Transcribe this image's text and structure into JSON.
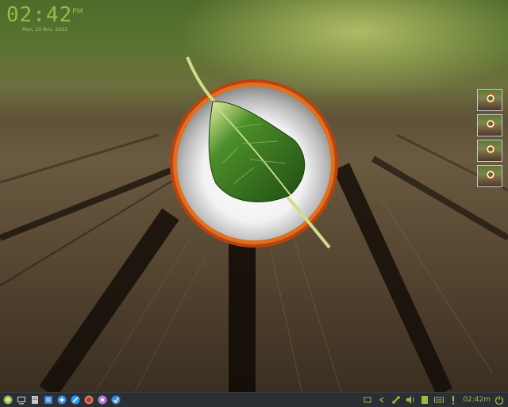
{
  "desktop": {
    "clock": {
      "time": "02:42",
      "ampm": "PM",
      "date": "Mon, 20 Nov, 2023"
    },
    "workspaces": [
      {
        "index": 1
      },
      {
        "index": 2
      },
      {
        "index": 3
      },
      {
        "index": 4
      }
    ]
  },
  "taskbar": {
    "launchers": [
      {
        "icon": "app-menu-icon"
      },
      {
        "icon": "terminal-icon"
      },
      {
        "icon": "file-manager-icon"
      },
      {
        "icon": "text-editor-icon"
      },
      {
        "icon": "settings-icon"
      },
      {
        "icon": "web-browser-icon"
      },
      {
        "icon": "firefox-icon"
      },
      {
        "icon": "media-player-icon"
      },
      {
        "icon": "software-center-icon"
      }
    ],
    "tray": {
      "clock": "02:42m",
      "icons": [
        "window-list-icon",
        "collapse-arrow-icon",
        "network-icon",
        "volume-icon",
        "clipboard-icon",
        "keyboard-icon",
        "update-notifier-icon",
        "power-icon"
      ]
    }
  },
  "colors": {
    "accent": "#8fbf4a",
    "panel": "#2b2f33",
    "logo_ring": "#d65a1a",
    "leaf": "#2f6e1c"
  }
}
